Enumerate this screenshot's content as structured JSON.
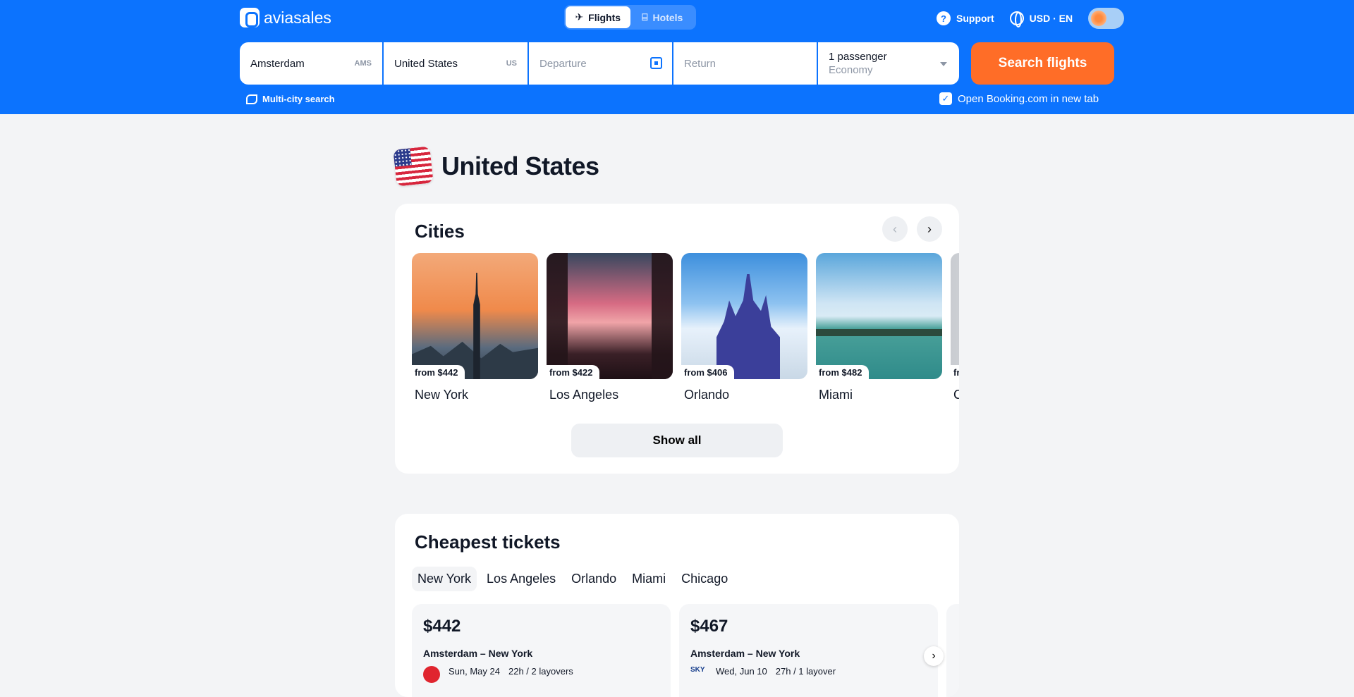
{
  "brand": {
    "name": "aviasales"
  },
  "modes": [
    {
      "label": "Flights"
    },
    {
      "label": "Hotels"
    }
  ],
  "header_links": {
    "support": "Support",
    "locale": "USD · EN"
  },
  "search": {
    "origin": "Amsterdam",
    "origin_code": "AMS",
    "destination": "United States",
    "destination_code": "US",
    "departure_placeholder": "Departure",
    "return_placeholder": "Return",
    "passengers": "1 passenger",
    "cabin": "Economy",
    "button": "Search flights",
    "multi_city": "Multi-city search",
    "open_booking": "Open Booking.com in new tab"
  },
  "country": {
    "title": "United States"
  },
  "cities": {
    "title": "Cities",
    "show_all": "Show all",
    "items": [
      {
        "price": "from $442",
        "name": "New York"
      },
      {
        "price": "from $422",
        "name": "Los Angeles"
      },
      {
        "price": "from $406",
        "name": "Orlando"
      },
      {
        "price": "from $482",
        "name": "Miami"
      },
      {
        "price": "fr",
        "name": "C"
      }
    ]
  },
  "tickets": {
    "title": "Cheapest tickets",
    "tabs": [
      "New York",
      "Los Angeles",
      "Orlando",
      "Miami",
      "Chicago"
    ],
    "items": [
      {
        "price": "$442",
        "route": "Amsterdam – New York",
        "date": "Sun, May 24",
        "duration": "22h / 2 layovers"
      },
      {
        "price": "$467",
        "route": "Amsterdam – New York",
        "date": "Wed, Jun 10",
        "duration": "27h / 1 layover"
      }
    ]
  },
  "colors": {
    "header": "#0c73fe",
    "accent": "#ff6d27",
    "page": "#f3f4f6"
  }
}
